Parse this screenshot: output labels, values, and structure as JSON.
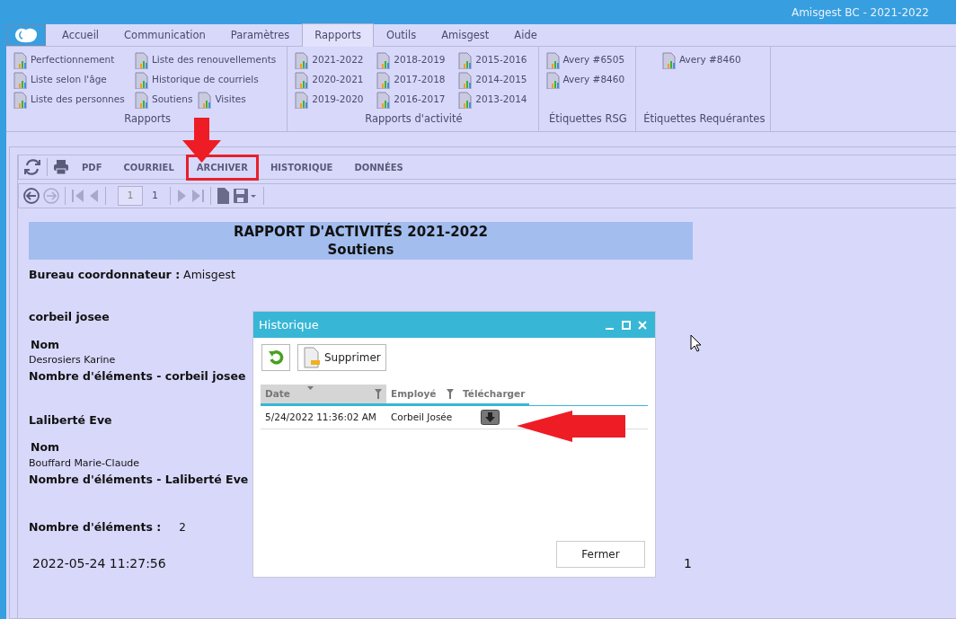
{
  "window": {
    "title": "Amisgest BC - 2021-2022"
  },
  "tabs": [
    {
      "label": "Accueil",
      "selected": false
    },
    {
      "label": "Communication",
      "selected": false
    },
    {
      "label": "Paramètres",
      "selected": false
    },
    {
      "label": "Rapports",
      "selected": true
    },
    {
      "label": "Outils",
      "selected": false
    },
    {
      "label": "Amisgest",
      "selected": false
    },
    {
      "label": "Aide",
      "selected": false
    }
  ],
  "ribbon_groups": [
    {
      "title": "Rapports",
      "rows": [
        [
          "Perfectionnement",
          "Liste des renouvellements"
        ],
        [
          "Liste selon l'âge",
          "Historique de courriels"
        ],
        [
          "Liste des personnes",
          "Soutiens",
          "Visites"
        ]
      ]
    },
    {
      "title": "Rapports d'activité",
      "rows": [
        [
          "2021-2022",
          "2018-2019",
          "2015-2016"
        ],
        [
          "2020-2021",
          "2017-2018",
          "2014-2015"
        ],
        [
          "2019-2020",
          "2016-2017",
          "2013-2014"
        ]
      ]
    },
    {
      "title": "Étiquettes RSG",
      "rows": [
        [
          "Avery #6505"
        ],
        [
          "Avery #8460"
        ]
      ]
    },
    {
      "title": "Étiquettes Requérantes",
      "rows": [
        [
          "Avery #8460"
        ]
      ]
    }
  ],
  "report_toolbar": [
    {
      "label": "PDF",
      "highlighted": false
    },
    {
      "label": "COURRIEL",
      "highlighted": false
    },
    {
      "label": "ARCHIVER",
      "highlighted": true
    },
    {
      "label": "HISTORIQUE",
      "highlighted": false
    },
    {
      "label": "DONNÉES",
      "highlighted": false
    }
  ],
  "pager": {
    "page": "1",
    "total": "1"
  },
  "report": {
    "title": "RAPPORT D'ACTIVITÉS 2021-2022",
    "subtitle": "Soutiens",
    "office": "**Bureau coordonnateur :** Amisgest",
    "sections": [
      {
        "name": "corbeil josee",
        "field_label": "Nom",
        "value": "Desrosiers Karine",
        "count_label": "Nombre d'éléments - corbeil josee"
      },
      {
        "name": "Laliberté Eve",
        "field_label": "Nom",
        "value": "Bouffard Marie-Claude",
        "count_label": "Nombre d'éléments - Laliberté Eve"
      }
    ],
    "total_label": "Nombre d'éléments :",
    "total_value": "2",
    "printed_at": "2022-05-24 11:27:56",
    "page_number": "1"
  },
  "dialog": {
    "title": "Historique",
    "delete_label": "Supprimer",
    "columns": [
      {
        "label": "Date",
        "sorted": true,
        "filter": true
      },
      {
        "label": "Employé",
        "sorted": false,
        "filter": true
      },
      {
        "label": "Télécharger",
        "sorted": false,
        "filter": false
      }
    ],
    "rows": [
      {
        "date": "5/24/2022 11:36:02 AM",
        "employee": "Corbeil Josée"
      }
    ],
    "close_label": "Fermer"
  }
}
